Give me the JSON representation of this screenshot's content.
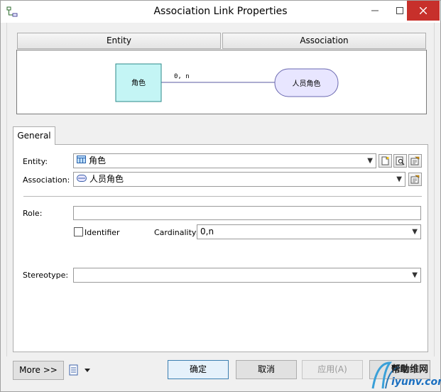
{
  "window": {
    "title": "Association Link Properties"
  },
  "header": {
    "entity_label": "Entity",
    "association_label": "Association"
  },
  "diagram": {
    "entity_name": "角色",
    "link_label": "0, n",
    "association_name": "人员角色"
  },
  "tabs": [
    {
      "label": "General"
    }
  ],
  "form": {
    "entity_label": "Entity:",
    "entity_value": "角色",
    "association_label": "Association:",
    "association_value": "人员角色",
    "role_label": "Role:",
    "role_value": "",
    "identifier_label": "Identifier",
    "identifier_checked": false,
    "cardinality_label": "Cardinality:",
    "cardinality_value": "0,n",
    "stereotype_label": "Stereotype:",
    "stereotype_value": ""
  },
  "footer": {
    "more_label": "More >>",
    "ok_label": "确定",
    "cancel_label": "取消",
    "apply_label": "应用(A)",
    "help_label": "帮助"
  },
  "watermark": {
    "line1": "帮助维网",
    "line2": "iyunv.com"
  },
  "colors": {
    "entity_fill": "#c4f5f5",
    "entity_border": "#2d8a8a",
    "association_fill": "#e8e6ff",
    "association_border": "#6a68b0",
    "link_color": "#5a5aa0",
    "close_button": "#c7302b"
  }
}
